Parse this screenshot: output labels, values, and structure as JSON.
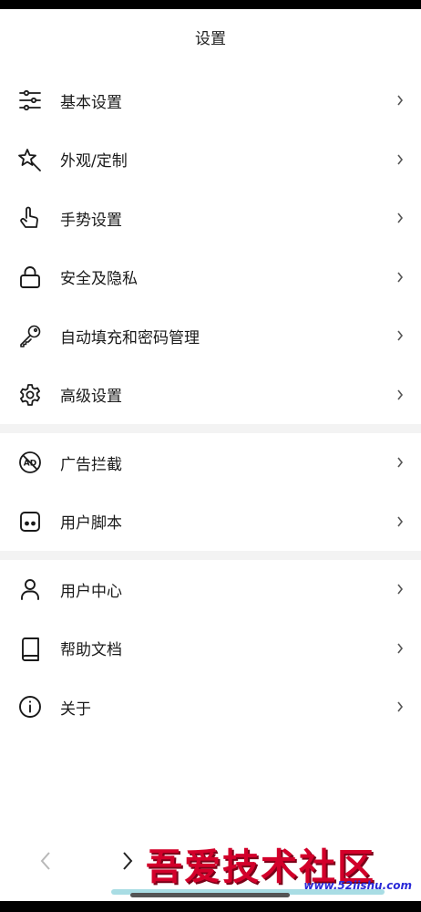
{
  "header": {
    "title": "设置"
  },
  "groups": [
    {
      "items": [
        {
          "name": "basic-settings",
          "label": "基本设置",
          "icon": "sliders-icon"
        },
        {
          "name": "appearance",
          "label": "外观/定制",
          "icon": "magic-wand-icon"
        },
        {
          "name": "gesture-settings",
          "label": "手势设置",
          "icon": "hand-pointer-icon"
        },
        {
          "name": "security-privacy",
          "label": "安全及隐私",
          "icon": "lock-icon"
        },
        {
          "name": "autofill-passwords",
          "label": "自动填充和密码管理",
          "icon": "key-icon"
        },
        {
          "name": "advanced-settings",
          "label": "高级设置",
          "icon": "gear-icon"
        }
      ]
    },
    {
      "items": [
        {
          "name": "ad-block",
          "label": "广告拦截",
          "icon": "ad-block-icon"
        },
        {
          "name": "user-scripts",
          "label": "用户脚本",
          "icon": "script-icon"
        }
      ]
    },
    {
      "items": [
        {
          "name": "user-center",
          "label": "用户中心",
          "icon": "user-icon"
        },
        {
          "name": "help-docs",
          "label": "帮助文档",
          "icon": "book-icon"
        },
        {
          "name": "about",
          "label": "关于",
          "icon": "info-icon"
        }
      ]
    }
  ],
  "watermark": {
    "text": "吾爱技术社区",
    "url": "www.52jishu.com"
  },
  "colors": {
    "background": "#ffffff",
    "divider": "#f3f3f3",
    "text": "#1a1a1a",
    "chevron": "#555555"
  }
}
